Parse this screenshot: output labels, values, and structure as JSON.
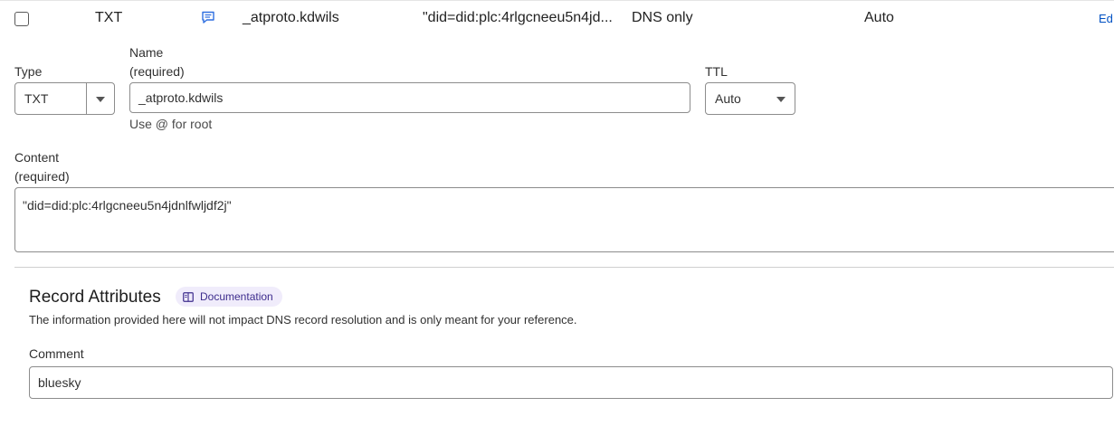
{
  "record_row": {
    "type": "TXT",
    "name": "_atproto.kdwils",
    "content_truncated": "\"did=did:plc:4rlgcneeu5n4jd...",
    "proxy_status": "DNS only",
    "ttl": "Auto",
    "edit_label": "Ed"
  },
  "form": {
    "type_label": "Type",
    "type_value": "TXT",
    "name_label": "Name",
    "name_required": "(required)",
    "name_value": "_atproto.kdwils",
    "name_help": "Use @ for root",
    "ttl_label": "TTL",
    "ttl_value": "Auto",
    "content_label": "Content",
    "content_required": "(required)",
    "content_value": "\"did=did:plc:4rlgcneeu5n4jdnlfwljdf2j\""
  },
  "attributes": {
    "title": "Record Attributes",
    "doc_link": "Documentation",
    "description": "The information provided here will not impact DNS record resolution and is only meant for your reference.",
    "comment_label": "Comment",
    "comment_value": "bluesky"
  },
  "colors": {
    "link": "#0051c3",
    "doc_pill_bg": "#f0ecfb",
    "doc_pill_text": "#3d2c8d",
    "comment_icon": "#2f6fe0"
  }
}
